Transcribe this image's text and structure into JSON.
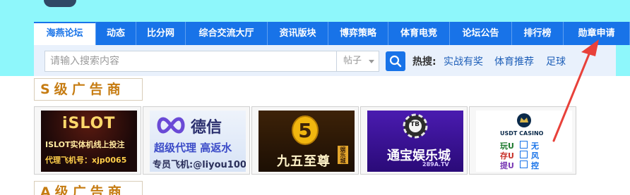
{
  "nav": {
    "tabs": [
      "海燕论坛",
      "动态",
      "比分网",
      "综合交流大厅",
      "资讯版块",
      "博弈策略",
      "体育电竞",
      "论坛公告",
      "排行榜",
      "勋章申请"
    ]
  },
  "search": {
    "placeholder": "请输入搜索内容",
    "scope": "帖子",
    "hot_label": "热搜:",
    "hot_links": [
      "实战有奖",
      "体育推荐",
      "足球"
    ]
  },
  "sections": {
    "s_title": "S级广告商",
    "a_title": "A级广告商"
  },
  "ads": [
    {
      "name": "iSLOT",
      "tagline": "ISLOT实体机线上投注",
      "contact": "代理飞机号：xjp0065"
    },
    {
      "name": "德信",
      "tagline": "超级代理 高返水",
      "contact": "专员飞机:@liyou100"
    },
    {
      "name": "九五至尊",
      "badge": "娱乐城"
    },
    {
      "name": "通宝娱乐城",
      "sub": "289A.TV",
      "logo": "TB"
    },
    {
      "name": "USDT CASINO",
      "lines": [
        "玩U",
        "存U",
        "提U"
      ],
      "marks": [
        "无",
        "风",
        "控"
      ]
    }
  ],
  "colors": {
    "nav_blue": "#1873e8",
    "top_band": "#8ef7fb",
    "section_gold": "#c67c12",
    "arrow_red": "#e8413a"
  }
}
